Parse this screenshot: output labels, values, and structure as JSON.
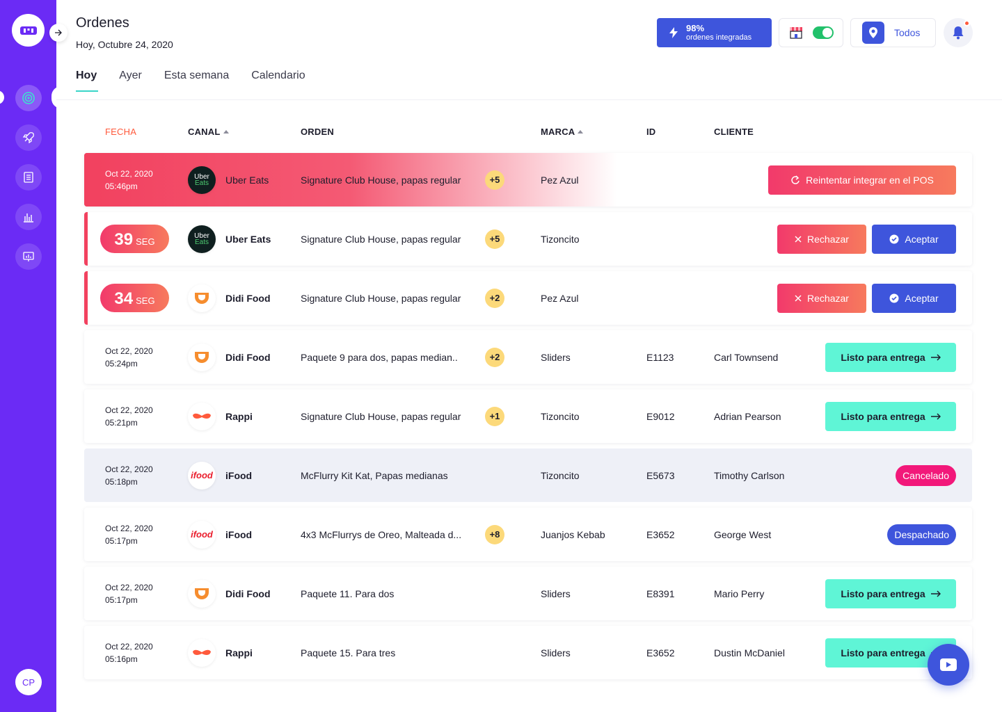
{
  "sidebar": {
    "avatar_initials": "CP"
  },
  "header": {
    "title": "Ordenes",
    "date": "Hoy, Octubre 24, 2020",
    "integration_pct": "98%",
    "integration_label": "ordenes integradas",
    "location_label": "Todos"
  },
  "tabs": [
    "Hoy",
    "Ayer",
    "Esta semana",
    "Calendario"
  ],
  "columns": {
    "fecha": "FECHA",
    "canal": "CANAL",
    "orden": "ORDEN",
    "marca": "MARCA",
    "id": "ID",
    "cliente": "CLIENTE"
  },
  "rows": [
    {
      "date": "Oct 22, 2020",
      "time": "05:46pm",
      "channel": "Uber Eats",
      "order": "Signature Club House, papas regular",
      "extra": "+5",
      "brand": "Pez Azul",
      "id": "",
      "client": "",
      "action": "Reintentar integrar en el POS"
    },
    {
      "timer": "39",
      "timer_unit": "SEG",
      "channel": "Uber Eats",
      "order": "Signature Club House, papas regular",
      "extra": "+5",
      "brand": "Tizoncito",
      "id": "",
      "client": "",
      "reject": "Rechazar",
      "accept": "Aceptar"
    },
    {
      "timer": "34",
      "timer_unit": "SEG",
      "channel": "Didi Food",
      "order": "Signature Club House, papas regular",
      "extra": "+2",
      "brand": "Pez Azul",
      "id": "",
      "client": "",
      "reject": "Rechazar",
      "accept": "Aceptar"
    },
    {
      "date": "Oct 22, 2020",
      "time": "05:24pm",
      "channel": "Didi Food",
      "order": "Paquete 9 para dos, papas median..",
      "extra": "+2",
      "brand": "Sliders",
      "id": "E1123",
      "client": "Carl Townsend",
      "action": "Listo para entrega"
    },
    {
      "date": "Oct 22, 2020",
      "time": "05:21pm",
      "channel": "Rappi",
      "order": "Signature Club House, papas regular",
      "extra": "+1",
      "brand": "Tizoncito",
      "id": "E9012",
      "client": "Adrian Pearson",
      "action": "Listo para entrega"
    },
    {
      "date": "Oct 22, 2020",
      "time": "05:18pm",
      "channel": "iFood",
      "order": "McFlurry Kit Kat, Papas medianas",
      "extra": "",
      "brand": "Tizoncito",
      "id": "E5673",
      "client": "Timothy Carlson",
      "status": "Cancelado"
    },
    {
      "date": "Oct 22, 2020",
      "time": "05:17pm",
      "channel": "iFood",
      "order": "4x3 McFlurrys de Oreo, Malteada d...",
      "extra": "+8",
      "brand": "Juanjos Kebab",
      "id": "E3652",
      "client": "George West",
      "status": "Despachado"
    },
    {
      "date": "Oct 22, 2020",
      "time": "05:17pm",
      "channel": "Didi Food",
      "order": "Paquete 11. Para dos",
      "extra": "",
      "brand": "Sliders",
      "id": "E8391",
      "client": "Mario Perry",
      "action": "Listo para entrega"
    },
    {
      "date": "Oct 22, 2020",
      "time": "05:16pm",
      "channel": "Rappi",
      "order": "Paquete 15. Para tres",
      "extra": "",
      "brand": "Sliders",
      "id": "E3652",
      "client": "Dustin McDaniel",
      "action": "Listo para entrega"
    }
  ],
  "logos": {
    "uber_line1": "Uber",
    "uber_line2": "Eats",
    "ifood": "ifood"
  },
  "colors": {
    "primary": "#6b2bf5",
    "accent_blue": "#3e55dc",
    "danger": "#f2415f",
    "ready": "#5ff5d6",
    "tab_indicator": "#39d5c8"
  }
}
